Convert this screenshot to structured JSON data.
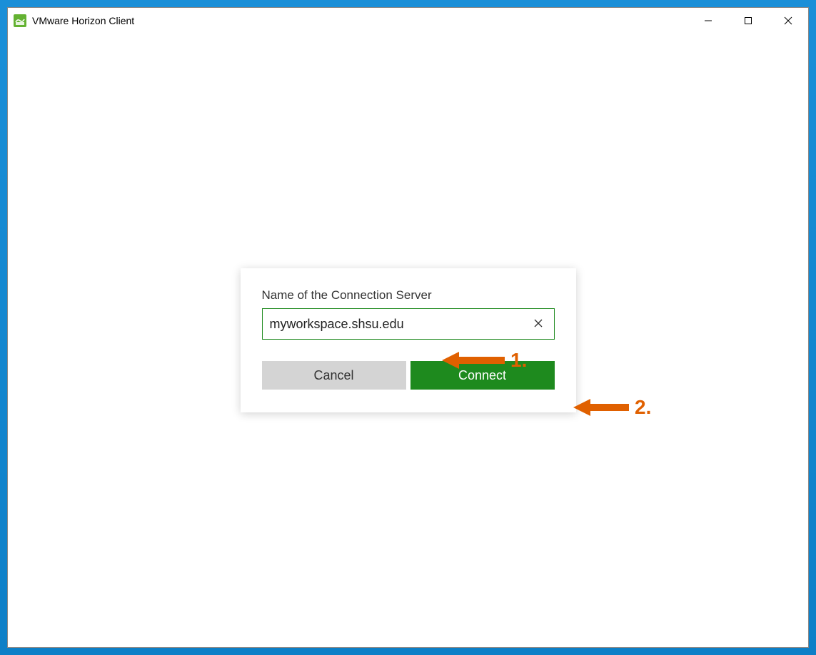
{
  "window": {
    "title": "VMware Horizon Client"
  },
  "dialog": {
    "label": "Name of the Connection Server",
    "server_value": "myworkspace.shsu.edu",
    "cancel_label": "Cancel",
    "connect_label": "Connect"
  },
  "annotations": {
    "step1": "1.",
    "step2": "2."
  },
  "colors": {
    "accent_green": "#1e8a1e",
    "annotation_orange": "#e06000",
    "desktop_blue": "#1a8fd8"
  }
}
